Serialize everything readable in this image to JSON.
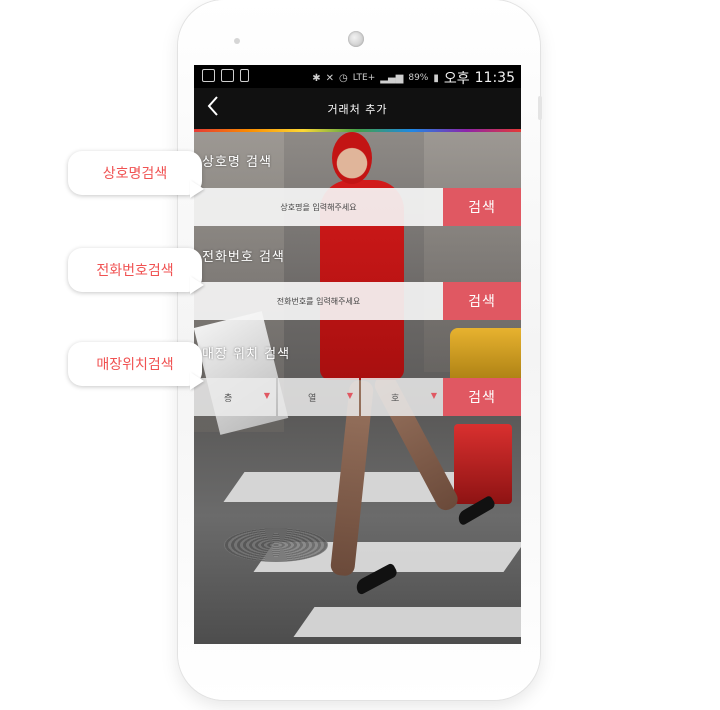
{
  "status_bar": {
    "network": "LTE+",
    "battery": "89%",
    "ampm": "오후",
    "time": "11:35"
  },
  "app_bar": {
    "back_icon": "chevron-left-icon",
    "title": "거래처 추가"
  },
  "sections": {
    "name": {
      "label": "상호명 검색",
      "placeholder": "상호명을 입력해주세요",
      "button": "검색"
    },
    "phone": {
      "label": "전화번호 검색",
      "placeholder": "전화번호를 입력해주세요",
      "button": "검색"
    },
    "location": {
      "label": "매장 위치 검색",
      "floor": "층",
      "row": "열",
      "number": "호",
      "button": "검색"
    }
  },
  "callouts": {
    "name": "상호명검색",
    "phone": "전화번호검색",
    "location": "매장위치검색"
  },
  "colors": {
    "accent": "#e05862",
    "callout_text": "#f05252",
    "app_bar": "#111111"
  }
}
